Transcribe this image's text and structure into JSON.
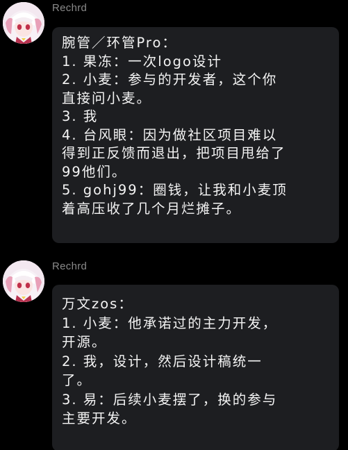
{
  "messages": [
    {
      "sender": "Rechrd",
      "lines": [
        "腕管／环管Pro：",
        "1. 果冻：一次logo设计",
        "2. 小麦：参与的开发者，这个你",
        "直接问小麦。",
        "3. 我",
        "4. 台风眼：因为做社区项目难以",
        "得到正反馈而退出，把项目甩给了",
        "99他们。",
        "5. gohj99：圈钱，让我和小麦顶",
        "着高压收了几个月烂摊子。"
      ]
    },
    {
      "sender": "Rechrd",
      "lines": [
        "万文zos：",
        "1. 小麦：他承诺过的主力开发，",
        "开源。",
        "2. 我，设计，然后设计稿统一",
        "了。",
        "3. 易：后续小麦摆了，换的参与",
        "主要开发。"
      ]
    }
  ],
  "colors": {
    "background": "#000000",
    "bubble": "#1d1e21",
    "sender": "#8a8a8a",
    "text": "#f4f4f4"
  },
  "icons": {
    "avatar": "anime-girl-avatar"
  }
}
